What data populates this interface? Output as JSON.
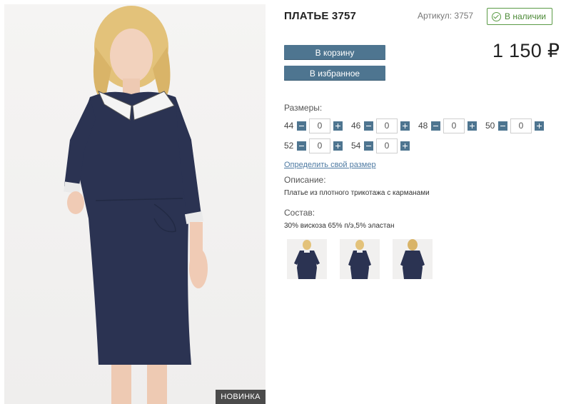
{
  "product": {
    "title": "ПЛАТЬЕ 3757",
    "sku_text": "Артикул: 3757",
    "stock_text": "В наличии",
    "price": "1 150 ₽",
    "badge": "НОВИНКА"
  },
  "buttons": {
    "cart": "В корзину",
    "favorite": "В избранное"
  },
  "sizes": {
    "label": "Размеры:",
    "items": [
      {
        "size": "44",
        "qty": "0"
      },
      {
        "size": "46",
        "qty": "0"
      },
      {
        "size": "48",
        "qty": "0"
      },
      {
        "size": "50",
        "qty": "0"
      },
      {
        "size": "52",
        "qty": "0"
      },
      {
        "size": "54",
        "qty": "0"
      }
    ],
    "link": "Определить свой размер"
  },
  "description": {
    "label": "Описание:",
    "text": "Платье из плотного трикотажа с карманами"
  },
  "composition": {
    "label": "Состав:",
    "text": "30% вискоза 65% п/э,5% эластан"
  },
  "colors": {
    "accent": "#4e7590",
    "stock_green": "#5b9b46",
    "dress_navy": "#2b3352"
  }
}
